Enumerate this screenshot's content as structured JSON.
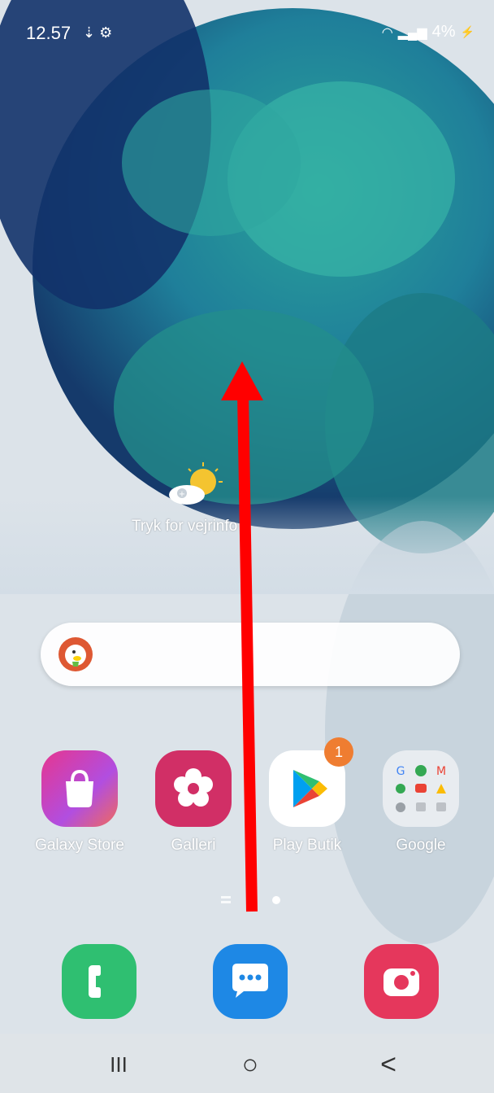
{
  "status_bar": {
    "time": "12.57",
    "battery": "4%"
  },
  "weather": {
    "text": "Tryk for vejrinfo"
  },
  "home_apps": [
    {
      "label": "Galaxy Store"
    },
    {
      "label": "Galleri"
    },
    {
      "label": "Play Butik",
      "badge": "1"
    },
    {
      "label": "Google"
    }
  ],
  "dock_apps": [
    {
      "name": "phone-app-icon"
    },
    {
      "name": "messages-app-icon"
    },
    {
      "name": "camera-app-icon"
    }
  ],
  "nav": {
    "recents": "III",
    "home": "○",
    "back": "<"
  },
  "colors": {
    "arrow": "#ff0000",
    "badge": "#ef7d31"
  }
}
